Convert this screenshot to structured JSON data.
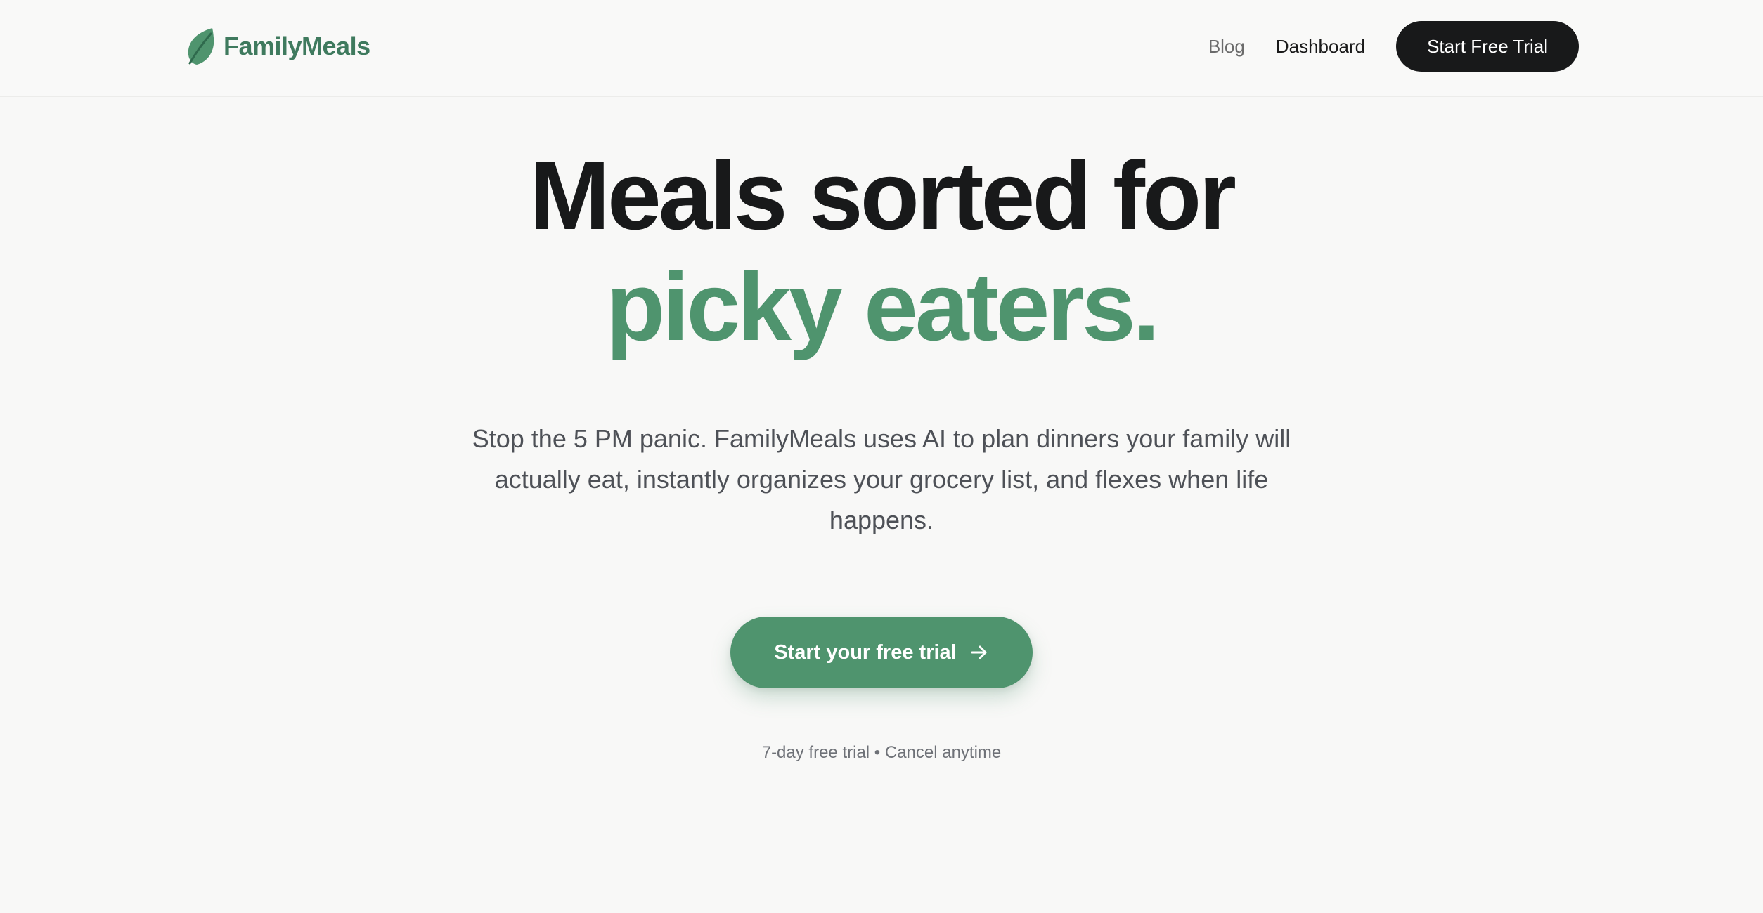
{
  "brand": {
    "name": "FamilyMeals",
    "color": "#3f7a5e",
    "icon": "leaf-icon"
  },
  "nav": {
    "blog": "Blog",
    "dashboard": "Dashboard",
    "cta": "Start Free Trial"
  },
  "hero": {
    "headline_line1": "Meals sorted for",
    "headline_line2": "picky eaters.",
    "subtitle": "Stop the 5 PM panic. FamilyMeals uses AI to plan dinners your family will actually eat, instantly organizes your grocery list, and flexes when life happens.",
    "cta_label": "Start your free trial",
    "cta_icon": "arrow-right-icon",
    "fineprint": "7-day free trial • Cancel anytime"
  },
  "colors": {
    "accent": "#4f946e",
    "text": "#18191a",
    "muted": "#6e7177",
    "background": "#f8f8f7"
  }
}
